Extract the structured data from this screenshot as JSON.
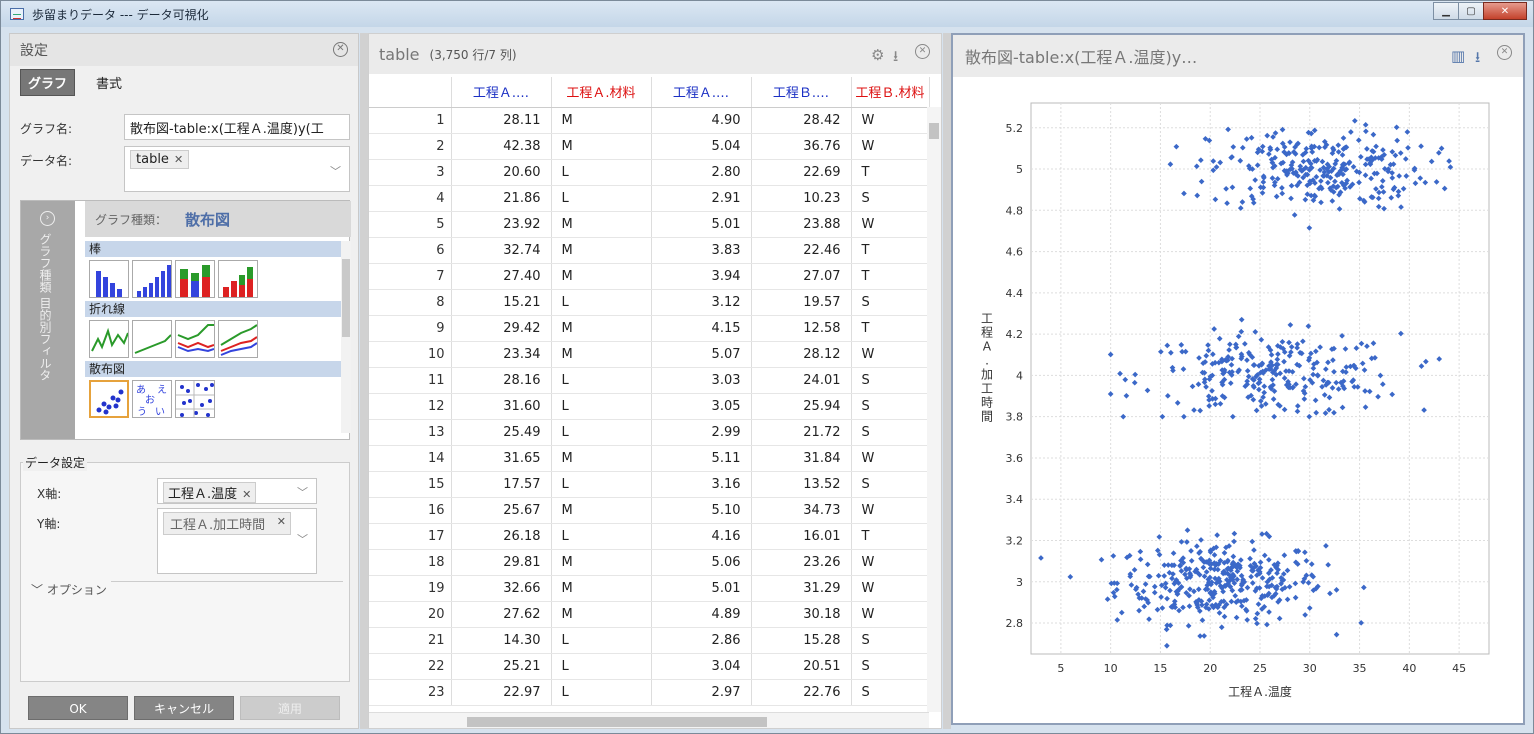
{
  "window": {
    "title": "歩留まりデータ --- データ可視化"
  },
  "settings": {
    "header": "設定",
    "tabs": [
      "グラフ",
      "書式"
    ],
    "graph_name_label": "グラフ名:",
    "graph_name_value": "散布図-table:x(工程Ａ.温度)y(工",
    "data_name_label": "データ名:",
    "data_name_chip": "table",
    "graph_types_sidebar": "グラフ種類\n目的別フィルタ",
    "graph_type_label": "グラフ種類：",
    "graph_type_value": "散布図",
    "categories": [
      "棒",
      "折れ線",
      "散布図"
    ],
    "data_settings_label": "データ設定",
    "x_axis_label": "X軸:",
    "x_axis_value": "工程Ａ.温度",
    "y_axis_label": "Y軸:",
    "y_axis_value": "工程Ａ.加工時間",
    "options_label": "オプション",
    "buttons": {
      "ok": "OK",
      "cancel": "キャンセル",
      "apply": "適用"
    }
  },
  "table": {
    "title": "table",
    "subtitle": "(3,750 行/7 列)",
    "columns": [
      {
        "label": "工程Ａ.…",
        "color": "#1a2fc4"
      },
      {
        "label": "工程Ａ.材料",
        "color": "#dd1111"
      },
      {
        "label": "工程Ａ.…",
        "color": "#1a2fc4"
      },
      {
        "label": "工程Ｂ.…",
        "color": "#1a2fc4"
      },
      {
        "label": "工程Ｂ.材料",
        "color": "#dd1111"
      }
    ],
    "rows": [
      [
        "1",
        "28.11",
        "M",
        "4.90",
        "28.42",
        "W"
      ],
      [
        "2",
        "42.38",
        "M",
        "5.04",
        "36.76",
        "W"
      ],
      [
        "3",
        "20.60",
        "L",
        "2.80",
        "22.69",
        "T"
      ],
      [
        "4",
        "21.86",
        "L",
        "2.91",
        "10.23",
        "S"
      ],
      [
        "5",
        "23.92",
        "M",
        "5.01",
        "23.88",
        "W"
      ],
      [
        "6",
        "32.74",
        "M",
        "3.83",
        "22.46",
        "T"
      ],
      [
        "7",
        "27.40",
        "M",
        "3.94",
        "27.07",
        "T"
      ],
      [
        "8",
        "15.21",
        "L",
        "3.12",
        "19.57",
        "S"
      ],
      [
        "9",
        "29.42",
        "M",
        "4.15",
        "12.58",
        "T"
      ],
      [
        "10",
        "23.34",
        "M",
        "5.07",
        "28.12",
        "W"
      ],
      [
        "11",
        "28.16",
        "L",
        "3.03",
        "24.01",
        "S"
      ],
      [
        "12",
        "31.60",
        "L",
        "3.05",
        "25.94",
        "S"
      ],
      [
        "13",
        "25.49",
        "L",
        "2.99",
        "21.72",
        "S"
      ],
      [
        "14",
        "31.65",
        "M",
        "5.11",
        "31.84",
        "W"
      ],
      [
        "15",
        "17.57",
        "L",
        "3.16",
        "13.52",
        "S"
      ],
      [
        "16",
        "25.67",
        "M",
        "5.10",
        "34.73",
        "W"
      ],
      [
        "17",
        "26.18",
        "L",
        "4.16",
        "16.01",
        "T"
      ],
      [
        "18",
        "29.81",
        "M",
        "5.06",
        "23.26",
        "W"
      ],
      [
        "19",
        "32.66",
        "M",
        "5.01",
        "31.29",
        "W"
      ],
      [
        "20",
        "27.62",
        "M",
        "4.89",
        "30.18",
        "W"
      ],
      [
        "21",
        "14.30",
        "L",
        "2.86",
        "15.28",
        "S"
      ],
      [
        "22",
        "25.21",
        "L",
        "3.04",
        "20.51",
        "S"
      ],
      [
        "23",
        "22.97",
        "L",
        "2.97",
        "22.76",
        "S"
      ]
    ]
  },
  "chart_panel": {
    "title": "散布図-table:x(工程Ａ.温度)y…"
  },
  "chart_data": {
    "type": "scatter",
    "xlabel": "工程Ａ.温度",
    "ylabel": "工程Ａ.加工時間",
    "xlim": [
      2,
      48
    ],
    "ylim": [
      2.65,
      5.32
    ],
    "xticks": [
      5,
      10,
      15,
      20,
      25,
      30,
      35,
      40,
      45
    ],
    "yticks": [
      2.8,
      3,
      3.2,
      3.4,
      3.6,
      3.8,
      4,
      4.2,
      4.4,
      4.6,
      4.8,
      5,
      5.2
    ],
    "grid": true,
    "marker_color": "#3b68c8",
    "clusters": [
      {
        "n": 360,
        "x_mean": 21,
        "x_sd": 5.2,
        "x_min": 3,
        "x_max": 37,
        "y_mean": 3.0,
        "y_sd": 0.1,
        "y_min": 2.69,
        "y_max": 3.28
      },
      {
        "n": 270,
        "x_mean": 26,
        "x_sd": 6.5,
        "x_min": 10,
        "x_max": 43,
        "y_mean": 4.0,
        "y_sd": 0.1,
        "y_min": 3.8,
        "y_max": 4.27
      },
      {
        "n": 290,
        "x_mean": 31,
        "x_sd": 5.5,
        "x_min": 16,
        "x_max": 45,
        "y_mean": 5.0,
        "y_sd": 0.1,
        "y_min": 4.65,
        "y_max": 5.26
      }
    ]
  }
}
